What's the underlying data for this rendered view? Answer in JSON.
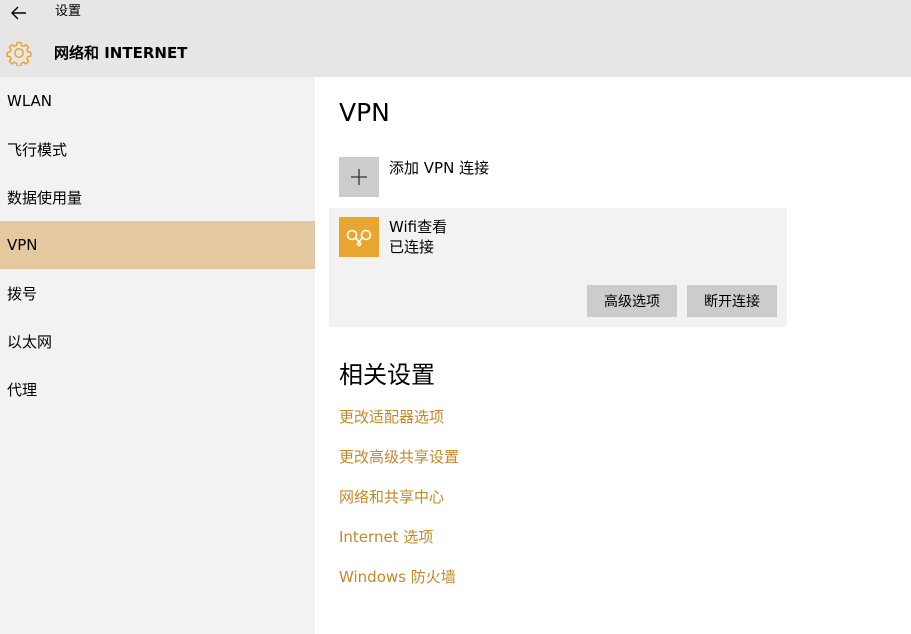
{
  "header": {
    "app_title": "设置",
    "section_title": "网络和 INTERNET"
  },
  "sidebar": {
    "items": [
      {
        "label": "WLAN"
      },
      {
        "label": "飞行模式"
      },
      {
        "label": "数据使用量"
      },
      {
        "label": "VPN"
      },
      {
        "label": "拨号"
      },
      {
        "label": "以太网"
      },
      {
        "label": "代理"
      }
    ],
    "active": "VPN"
  },
  "main": {
    "heading": "VPN",
    "add_label": "添加 VPN 连接",
    "connection": {
      "name": "Wifi查看",
      "status": "已连接",
      "advanced_button": "高级选项",
      "disconnect_button": "断开连接"
    },
    "related_heading": "相关设置",
    "related_links": [
      "更改适配器选项",
      "更改高级共享设置",
      "网络和共享中心",
      "Internet 选项",
      "Windows 防火墙"
    ]
  },
  "colors": {
    "accent": "#e8a530",
    "link": "#c2892a",
    "active_item": "#e4c9a0"
  },
  "icons": {
    "back": "back-arrow-icon",
    "gear": "gear-icon",
    "add": "plus-icon",
    "connection": "vpn-connection-icon"
  }
}
